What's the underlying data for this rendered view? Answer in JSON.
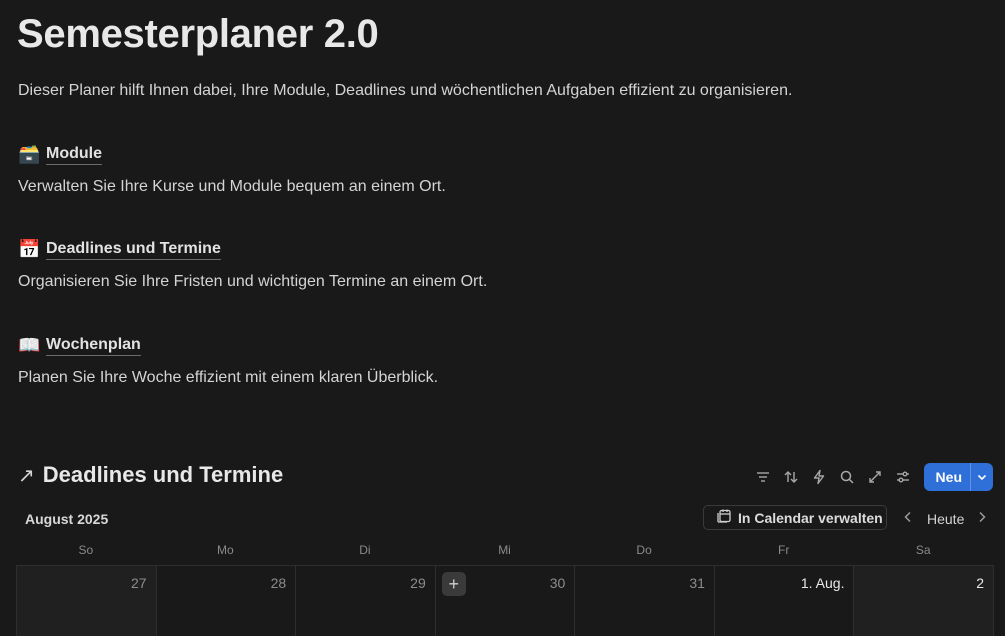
{
  "page": {
    "title": "Semesterplaner 2.0",
    "intro": "Dieser Planer hilft Ihnen dabei, Ihre Module, Deadlines und wöchentlichen Aufgaben effizient zu organisieren."
  },
  "sections": [
    {
      "emoji": "🗃️",
      "label": "Module",
      "description": "Verwalten Sie Ihre Kurse und Module bequem an einem Ort."
    },
    {
      "emoji": "📅",
      "label": "Deadlines und Termine",
      "description": "Organisieren Sie Ihre Fristen und wichtigen Termine an einem Ort."
    },
    {
      "emoji": "📖",
      "label": "Wochenplan",
      "description": "Planen Sie Ihre Woche effizient mit einem klaren Überblick."
    }
  ],
  "database": {
    "arrow": "↗",
    "title": "Deadlines und Termine",
    "new_label": "Neu",
    "toolbar_icons": [
      "filter-icon",
      "sort-icon",
      "automation-icon",
      "search-icon",
      "expand-icon",
      "settings-icon"
    ],
    "accent": "#2f6fd8"
  },
  "calendar": {
    "month": "August 2025",
    "gcal_label": "In Calendar verwalten",
    "today_label": "Heute",
    "weekdays": [
      "So",
      "Mo",
      "Di",
      "Mi",
      "Do",
      "Fr",
      "Sa"
    ],
    "days": [
      "27",
      "28",
      "29",
      "30",
      "31",
      "1. Aug.",
      "2"
    ]
  }
}
